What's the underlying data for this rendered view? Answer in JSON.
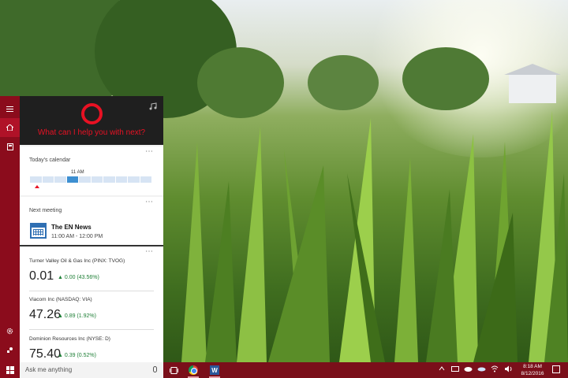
{
  "cortana": {
    "prompt": "What can I help you with next?"
  },
  "calendar_card": {
    "title": "Today's calendar",
    "time_marker": "11 AM"
  },
  "meeting_card": {
    "title": "Next meeting",
    "meeting_name": "The EN News",
    "meeting_time": "11:00 AM - 12:00 PM"
  },
  "stocks": [
    {
      "name": "Turner Valley Oil & Gas Inc (PINX: TVOG)",
      "price": "0.01",
      "change": "0.00 (43.56%)"
    },
    {
      "name": "Viacom Inc (NASDAQ: VIA)",
      "price": "47.26",
      "change": "0.89 (1.92%)"
    },
    {
      "name": "Dominion Resources Inc (NYSE: D)",
      "price": "75.40",
      "change": "0.39 (0.52%)"
    }
  ],
  "taskbar": {
    "search_placeholder": "Ask me anything",
    "time": "8:18 AM",
    "date": "8/12/2016"
  },
  "icons": {
    "card_more": "⋯",
    "chevron_down": "⌄",
    "up_arrow": "▲"
  },
  "colors": {
    "accent": "#e81123",
    "rail": "#8b0c1c",
    "taskbar": "#7a0f1a",
    "positive": "#1e7f36"
  }
}
